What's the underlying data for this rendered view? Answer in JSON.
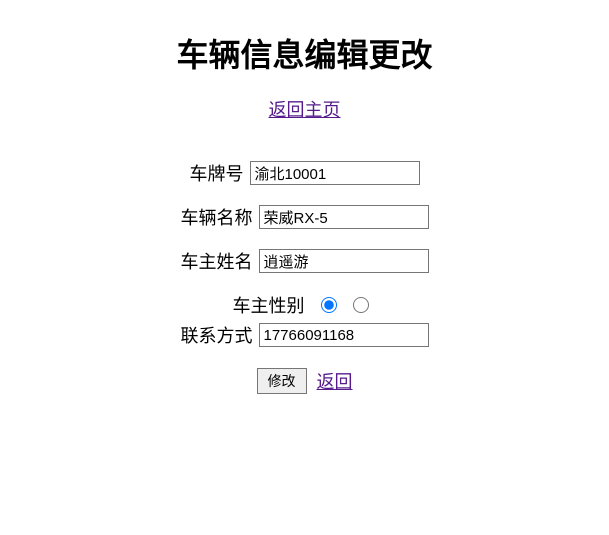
{
  "title": "车辆信息编辑更改",
  "homeLink": "返回主页",
  "fields": {
    "plateLabel": "车牌号",
    "plateValue": "渝北10001",
    "nameLabel": "车辆名称",
    "nameValue": "荣威RX-5",
    "ownerLabel": "车主姓名",
    "ownerValue": "逍遥游",
    "genderLabel": "车主性别",
    "contactLabel": "联系方式",
    "contactValue": "17766091168"
  },
  "buttons": {
    "submit": "修改",
    "back": "返回"
  }
}
